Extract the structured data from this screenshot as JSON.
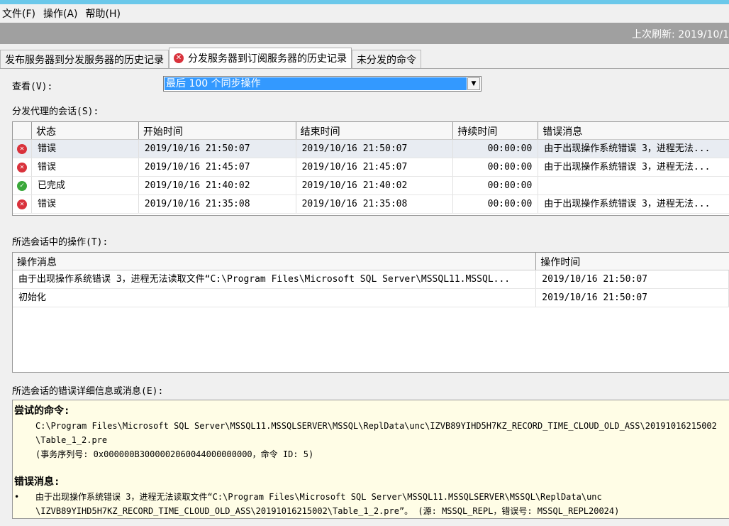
{
  "menu": [
    "文件(F)",
    "操作(A)",
    "帮助(H)"
  ],
  "banner": {
    "refresh": "上次刷新: 2019/10/1"
  },
  "tabs": [
    "发布服务器到分发服务器的历史记录",
    "分发服务器到订阅服务器的历史记录",
    "未分发的命令"
  ],
  "view": {
    "label": "查看(V):",
    "value": "最后 100 个同步操作"
  },
  "sessions": {
    "label": "分发代理的会话(S):",
    "columns": [
      "状态",
      "开始时间",
      "结束时间",
      "持续时间",
      "错误消息"
    ],
    "rows": [
      {
        "status": "错误",
        "icon": "error",
        "start": "2019/10/16 21:50:07",
        "end": "2019/10/16 21:50:07",
        "duration": "00:00:00",
        "message": "由于出现操作系统错误 3，进程无法..."
      },
      {
        "status": "错误",
        "icon": "error",
        "start": "2019/10/16 21:45:07",
        "end": "2019/10/16 21:45:07",
        "duration": "00:00:00",
        "message": "由于出现操作系统错误 3，进程无法..."
      },
      {
        "status": "已完成",
        "icon": "success",
        "start": "2019/10/16 21:40:02",
        "end": "2019/10/16 21:40:02",
        "duration": "00:00:00",
        "message": ""
      },
      {
        "status": "错误",
        "icon": "error",
        "start": "2019/10/16 21:35:08",
        "end": "2019/10/16 21:35:08",
        "duration": "00:00:00",
        "message": "由于出现操作系统错误 3，进程无法..."
      }
    ]
  },
  "actions": {
    "label": "所选会话中的操作(T):",
    "columns": [
      "操作消息",
      "操作时间"
    ],
    "rows": [
      {
        "message": "由于出现操作系统错误 3，进程无法读取文件“C:\\Program Files\\Microsoft SQL Server\\MSSQL11.MSSQL...",
        "time": "2019/10/16 21:50:07"
      },
      {
        "message": "初始化",
        "time": "2019/10/16 21:50:07"
      }
    ]
  },
  "details": {
    "label": "所选会话的错误详细信息或消息(E):",
    "cmd_heading": "尝试的命令:",
    "cmd_lines": [
      "C:\\Program Files\\Microsoft SQL Server\\MSSQL11.MSSQLSERVER\\MSSQL\\ReplData\\unc\\IZVB89YIHD5H7KZ_RECORD_TIME_CLOUD_OLD_ASS\\20191016215002",
      "\\Table_1_2.pre",
      "(事务序列号: 0x000000B3000002060044000000000，命令 ID: 5)"
    ],
    "err_heading": "错误消息:",
    "bullet": "•",
    "err_lines": [
      "由于出现操作系统错误 3，进程无法读取文件“C:\\Program Files\\Microsoft SQL Server\\MSSQL11.MSSQLSERVER\\MSSQL\\ReplData\\unc",
      "\\IZVB89YIHD5H7KZ_RECORD_TIME_CLOUD_OLD_ASS\\20191016215002\\Table_1_2.pre”。 (源: MSSQL_REPL，错误号: MSSQL_REPL20024)"
    ]
  }
}
